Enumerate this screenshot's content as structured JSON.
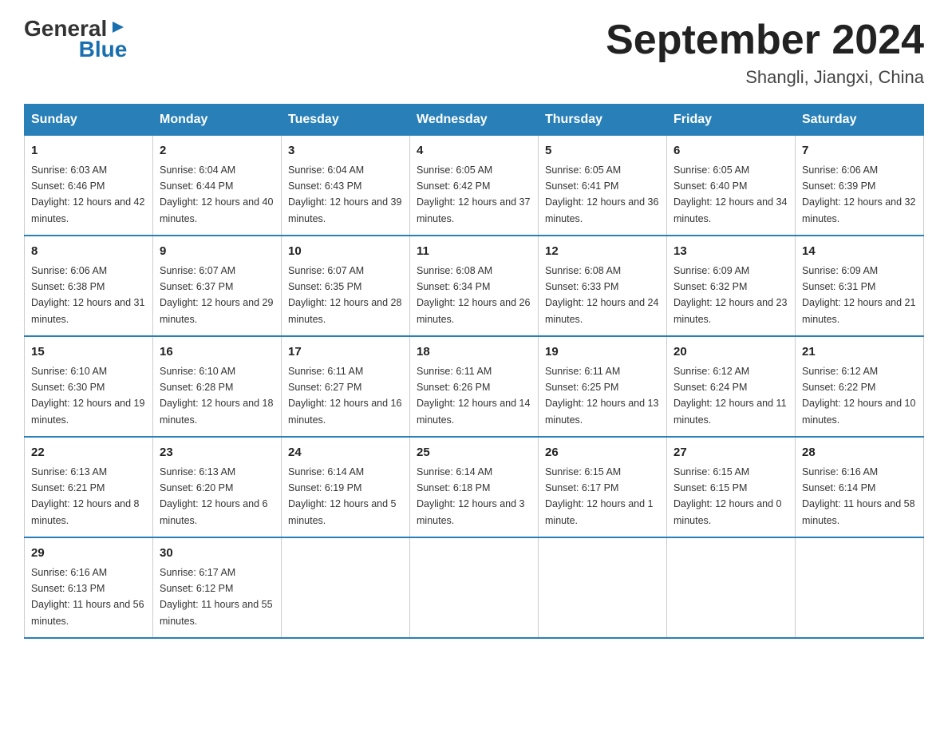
{
  "header": {
    "logo_general": "General",
    "logo_blue": "Blue",
    "month_title": "September 2024",
    "location": "Shangli, Jiangxi, China"
  },
  "days_of_week": [
    "Sunday",
    "Monday",
    "Tuesday",
    "Wednesday",
    "Thursday",
    "Friday",
    "Saturday"
  ],
  "weeks": [
    [
      {
        "day": "1",
        "sunrise": "6:03 AM",
        "sunset": "6:46 PM",
        "daylight": "12 hours and 42 minutes."
      },
      {
        "day": "2",
        "sunrise": "6:04 AM",
        "sunset": "6:44 PM",
        "daylight": "12 hours and 40 minutes."
      },
      {
        "day": "3",
        "sunrise": "6:04 AM",
        "sunset": "6:43 PM",
        "daylight": "12 hours and 39 minutes."
      },
      {
        "day": "4",
        "sunrise": "6:05 AM",
        "sunset": "6:42 PM",
        "daylight": "12 hours and 37 minutes."
      },
      {
        "day": "5",
        "sunrise": "6:05 AM",
        "sunset": "6:41 PM",
        "daylight": "12 hours and 36 minutes."
      },
      {
        "day": "6",
        "sunrise": "6:05 AM",
        "sunset": "6:40 PM",
        "daylight": "12 hours and 34 minutes."
      },
      {
        "day": "7",
        "sunrise": "6:06 AM",
        "sunset": "6:39 PM",
        "daylight": "12 hours and 32 minutes."
      }
    ],
    [
      {
        "day": "8",
        "sunrise": "6:06 AM",
        "sunset": "6:38 PM",
        "daylight": "12 hours and 31 minutes."
      },
      {
        "day": "9",
        "sunrise": "6:07 AM",
        "sunset": "6:37 PM",
        "daylight": "12 hours and 29 minutes."
      },
      {
        "day": "10",
        "sunrise": "6:07 AM",
        "sunset": "6:35 PM",
        "daylight": "12 hours and 28 minutes."
      },
      {
        "day": "11",
        "sunrise": "6:08 AM",
        "sunset": "6:34 PM",
        "daylight": "12 hours and 26 minutes."
      },
      {
        "day": "12",
        "sunrise": "6:08 AM",
        "sunset": "6:33 PM",
        "daylight": "12 hours and 24 minutes."
      },
      {
        "day": "13",
        "sunrise": "6:09 AM",
        "sunset": "6:32 PM",
        "daylight": "12 hours and 23 minutes."
      },
      {
        "day": "14",
        "sunrise": "6:09 AM",
        "sunset": "6:31 PM",
        "daylight": "12 hours and 21 minutes."
      }
    ],
    [
      {
        "day": "15",
        "sunrise": "6:10 AM",
        "sunset": "6:30 PM",
        "daylight": "12 hours and 19 minutes."
      },
      {
        "day": "16",
        "sunrise": "6:10 AM",
        "sunset": "6:28 PM",
        "daylight": "12 hours and 18 minutes."
      },
      {
        "day": "17",
        "sunrise": "6:11 AM",
        "sunset": "6:27 PM",
        "daylight": "12 hours and 16 minutes."
      },
      {
        "day": "18",
        "sunrise": "6:11 AM",
        "sunset": "6:26 PM",
        "daylight": "12 hours and 14 minutes."
      },
      {
        "day": "19",
        "sunrise": "6:11 AM",
        "sunset": "6:25 PM",
        "daylight": "12 hours and 13 minutes."
      },
      {
        "day": "20",
        "sunrise": "6:12 AM",
        "sunset": "6:24 PM",
        "daylight": "12 hours and 11 minutes."
      },
      {
        "day": "21",
        "sunrise": "6:12 AM",
        "sunset": "6:22 PM",
        "daylight": "12 hours and 10 minutes."
      }
    ],
    [
      {
        "day": "22",
        "sunrise": "6:13 AM",
        "sunset": "6:21 PM",
        "daylight": "12 hours and 8 minutes."
      },
      {
        "day": "23",
        "sunrise": "6:13 AM",
        "sunset": "6:20 PM",
        "daylight": "12 hours and 6 minutes."
      },
      {
        "day": "24",
        "sunrise": "6:14 AM",
        "sunset": "6:19 PM",
        "daylight": "12 hours and 5 minutes."
      },
      {
        "day": "25",
        "sunrise": "6:14 AM",
        "sunset": "6:18 PM",
        "daylight": "12 hours and 3 minutes."
      },
      {
        "day": "26",
        "sunrise": "6:15 AM",
        "sunset": "6:17 PM",
        "daylight": "12 hours and 1 minute."
      },
      {
        "day": "27",
        "sunrise": "6:15 AM",
        "sunset": "6:15 PM",
        "daylight": "12 hours and 0 minutes."
      },
      {
        "day": "28",
        "sunrise": "6:16 AM",
        "sunset": "6:14 PM",
        "daylight": "11 hours and 58 minutes."
      }
    ],
    [
      {
        "day": "29",
        "sunrise": "6:16 AM",
        "sunset": "6:13 PM",
        "daylight": "11 hours and 56 minutes."
      },
      {
        "day": "30",
        "sunrise": "6:17 AM",
        "sunset": "6:12 PM",
        "daylight": "11 hours and 55 minutes."
      },
      null,
      null,
      null,
      null,
      null
    ]
  ]
}
